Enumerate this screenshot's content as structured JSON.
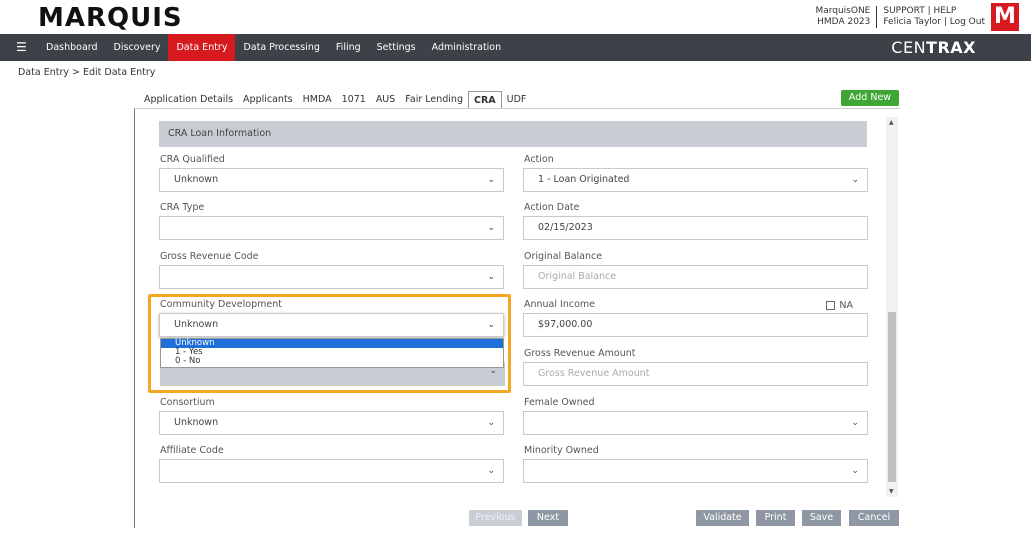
{
  "header": {
    "logo_text": "MARQUIS",
    "product": "MarquisONE",
    "dataset": "HMDA 2023",
    "support": "SUPPORT | HELP",
    "user": "Felicia Taylor | Log Out",
    "brand_mark": "M",
    "brand_color": "#d71920"
  },
  "nav": {
    "menu_icon": "hamburger-icon",
    "items": [
      "Dashboard",
      "Discovery",
      "Data Entry",
      "Data Processing",
      "Filing",
      "Settings",
      "Administration"
    ],
    "active": "Data Entry",
    "product_name_light": "CEN",
    "product_name_bold": "TRAX"
  },
  "breadcrumb": "Data Entry  >  Edit Data Entry",
  "tabs": [
    "Application Details",
    "Applicants",
    "HMDA",
    "1071",
    "AUS",
    "Fair Lending",
    "CRA",
    "UDF"
  ],
  "active_tab": "CRA",
  "add_new_label": "Add New",
  "section_title": "CRA Loan Information",
  "fields": {
    "cra_qualified": {
      "label": "CRA Qualified",
      "value": "Unknown"
    },
    "action": {
      "label": "Action",
      "value": "1 - Loan Originated"
    },
    "cra_type": {
      "label": "CRA Type",
      "value": ""
    },
    "action_date": {
      "label": "Action Date",
      "value": "02/15/2023"
    },
    "gross_revenue_code": {
      "label": "Gross Revenue Code",
      "value": ""
    },
    "original_balance": {
      "label": "Original Balance",
      "placeholder": "Original Balance"
    },
    "community_development": {
      "label": "Community Development",
      "value": "Unknown",
      "options": [
        "Unknown",
        "1 - Yes",
        "0 - No"
      ]
    },
    "annual_income": {
      "label": "Annual Income",
      "value": "$97,000.00",
      "na_label": "NA"
    },
    "gross_revenue_amount": {
      "label": "Gross Revenue Amount",
      "placeholder": "Gross Revenue Amount"
    },
    "consortium": {
      "label": "Consortium",
      "value": "Unknown"
    },
    "female_owned": {
      "label": "Female Owned",
      "value": ""
    },
    "affiliate_code": {
      "label": "Affiliate Code",
      "value": ""
    },
    "minority_owned": {
      "label": "Minority Owned",
      "value": ""
    }
  },
  "buttons": {
    "previous": "Previous",
    "next": "Next",
    "validate": "Validate",
    "print": "Print",
    "save": "Save",
    "cancel": "Cancel"
  },
  "colors": {
    "highlight": "#f5a623",
    "nav_bg": "#3d4249",
    "add_new": "#3fa535",
    "selected_option": "#1e6fd8"
  }
}
